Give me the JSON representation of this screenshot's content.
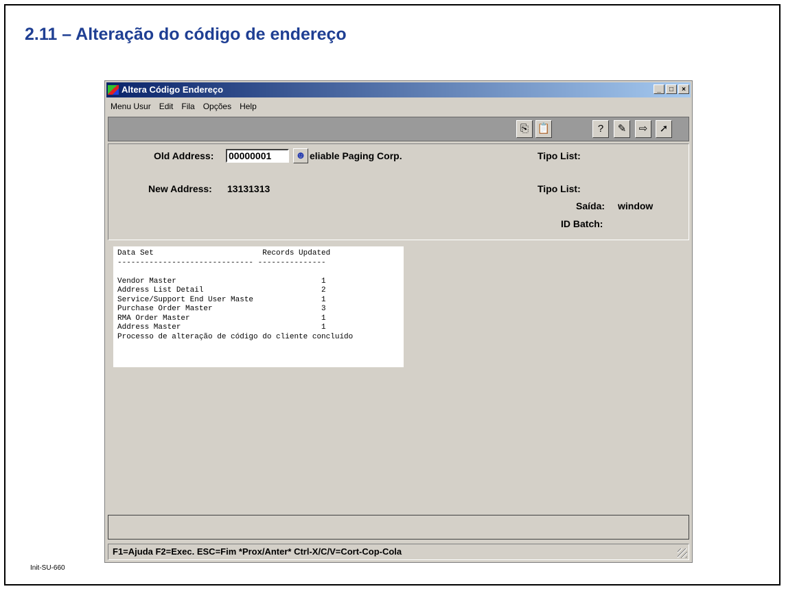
{
  "slide": {
    "title": "2.11 – Alteração do código de endereço",
    "footer": "Init-SU-660"
  },
  "window": {
    "title": "Altera Código Endereço",
    "controls": [
      "_",
      "□",
      "×"
    ]
  },
  "menu": {
    "items": [
      "Menu Usur",
      "Edit",
      "Fila",
      "Opções",
      "Help"
    ]
  },
  "toolbar": {
    "icons": [
      "copy-icon",
      "paste-icon",
      "help-query-icon",
      "edit-query-icon",
      "export-icon",
      "exit-icon"
    ]
  },
  "form": {
    "old_address_label": "Old Address:",
    "old_address_value": "00000001",
    "old_address_name": "eliable Paging Corp.",
    "new_address_label": "New Address:",
    "new_address_value": "13131313",
    "tipo_list_label_1": "Tipo List:",
    "tipo_list_label_2": "Tipo List:",
    "saida_label": "Saída:",
    "saida_value": "window",
    "id_batch_label": "ID Batch:"
  },
  "output": {
    "header": "Data Set                        Records Updated",
    "separator": "------------------------------ ---------------",
    "rows": [
      "Vendor Master                                1",
      "Address List Detail                          2",
      "Service/Support End User Maste               1",
      "Purchase Order Master                        3",
      "RMA Order Master                             1",
      "Address Master                               1"
    ],
    "message": "Processo de alteração de código do cliente concluído"
  },
  "statusbar": {
    "text": "F1=Ajuda F2=Exec. ESC=Fim *Prox/Anter* Ctrl-X/C/V=Cort-Cop-Cola"
  }
}
